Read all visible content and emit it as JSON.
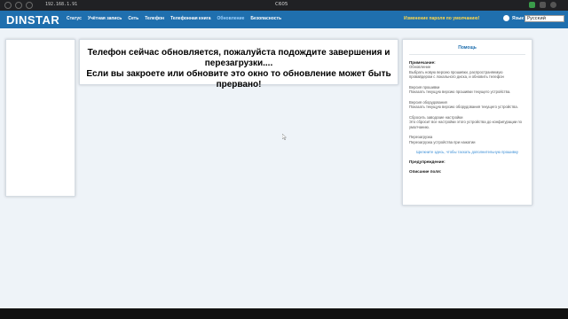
{
  "browser": {
    "url": "192.168.1.91",
    "window_title": "C605"
  },
  "header": {
    "logo": "DINSTAR",
    "menu": [
      "Статус",
      "Учётная запись",
      "Сеть",
      "Телефон",
      "Телефонная книга",
      "Обновление",
      "Безопасность"
    ],
    "active_menu": "Обновление",
    "password_warning": "Изменение пароля по умолчанию!",
    "language_label": "Язык",
    "language_value": "Русский"
  },
  "notice": {
    "line1": "Телефон сейчас обновляется, пожалуйста подождите завершения и перезагрузки....",
    "line2": "Если вы закроете или обновите это окно то обновление может быть прервано!"
  },
  "help": {
    "title": "Помощь",
    "note_heading": "Примечание:",
    "update_title": "Обновление",
    "update_text": "Выбрать новую версию прошивки, распространяемую провайдером с локального диска, и обновить телефон",
    "fw_title": "Версия прошивки",
    "fw_text": "Показать текущую версию прошивки текущего устройства.",
    "hw_title": "Версия оборудования",
    "hw_text": "Показать текущую версию оборудования текущего устройства.",
    "reset_title": "Сбросить заводские настройки",
    "reset_text": "Это сбросит все настройки этого устройства до конфигурации по умолчанию.",
    "reboot_title": "Перезагрузка",
    "reboot_text": "Перезагрузка устройства при нажатии",
    "link": "Щелкните здесь, чтобы таскать дополнительную прошивку",
    "warning_heading": "Предупреждение:",
    "description_heading": "Описание поля:"
  }
}
